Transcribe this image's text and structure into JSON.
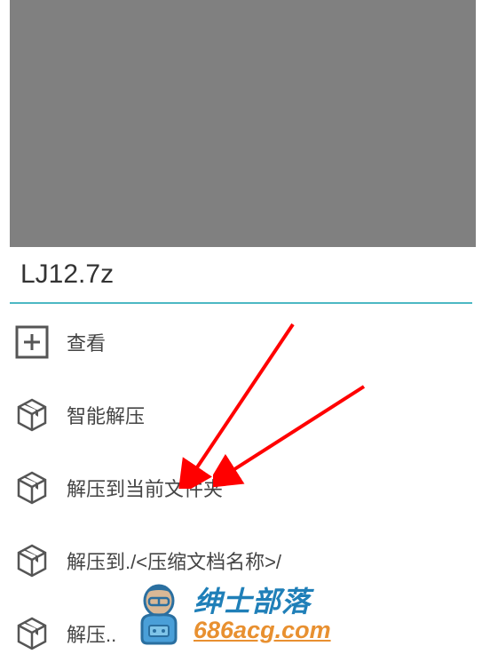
{
  "sheet": {
    "title": "LJ12.7z",
    "items": [
      {
        "label": "查看",
        "icon": "view"
      },
      {
        "label": "智能解压",
        "icon": "box"
      },
      {
        "label": "解压到当前文件夹",
        "icon": "box"
      },
      {
        "label": "解压到./<压缩文档名称>/",
        "icon": "box"
      },
      {
        "label": "解压..",
        "icon": "box"
      }
    ]
  },
  "watermark": {
    "line1": "绅士部落",
    "line2": "686acg.com"
  }
}
